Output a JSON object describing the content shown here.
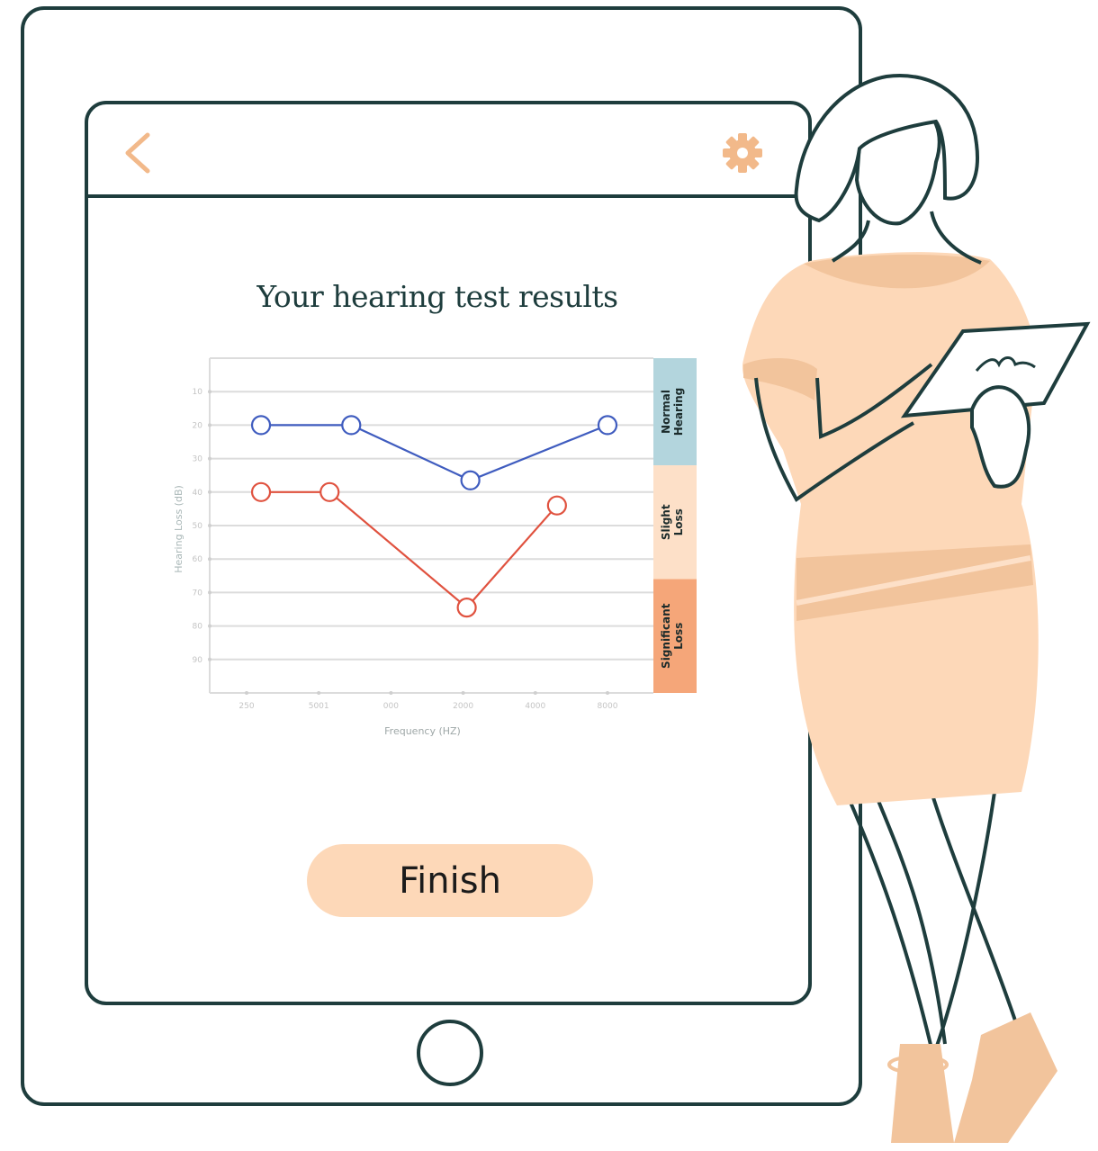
{
  "screen": {
    "title": "Your hearing test results",
    "finish_label": "Finish"
  },
  "icons": {
    "back": "chevron-left-icon",
    "settings": "gear-icon",
    "home": "home-button-circle"
  },
  "colors": {
    "device_outline": "#1e3d3d",
    "accent": "#f2b98a",
    "button_fill": "#fdd8b8",
    "right_ear": "#3f5cbf",
    "left_ear": "#e0523f",
    "normal_band": "#b3d5dd",
    "slight_band": "#fde0c8",
    "significant_band": "#f5a679",
    "grid": "#dcdcdc"
  },
  "chart_data": {
    "type": "line",
    "xlabel": "Frequency (HZ)",
    "ylabel": "Hearing Loss (dB)",
    "x_ticks": [
      "250",
      "5001",
      "000",
      "2000",
      "4000",
      "8000"
    ],
    "y_ticks": [
      "10",
      "20",
      "30",
      "40",
      "50",
      "60",
      "70",
      "80",
      "90"
    ],
    "ylim": [
      0,
      100
    ],
    "y_inverted": true,
    "grid": true,
    "bands": [
      {
        "label_line1": "Normal",
        "label_line2": "Hearing",
        "from": 0,
        "to": 32
      },
      {
        "label_line1": "Slight",
        "label_line2": "Loss",
        "from": 32,
        "to": 66
      },
      {
        "label_line1": "Significant",
        "label_line2": "Loss",
        "from": 66,
        "to": 100
      }
    ],
    "series": [
      {
        "color": "#3f5cbf",
        "points": [
          {
            "x": 0.2,
            "y": 20
          },
          {
            "x": 1.45,
            "y": 20
          },
          {
            "x": 3.1,
            "y": 36.5
          },
          {
            "x": 5.0,
            "y": 20
          }
        ]
      },
      {
        "color": "#e0523f",
        "points": [
          {
            "x": 0.2,
            "y": 40
          },
          {
            "x": 1.15,
            "y": 40
          },
          {
            "x": 3.05,
            "y": 74.5
          },
          {
            "x": 4.3,
            "y": 44
          }
        ]
      }
    ]
  }
}
